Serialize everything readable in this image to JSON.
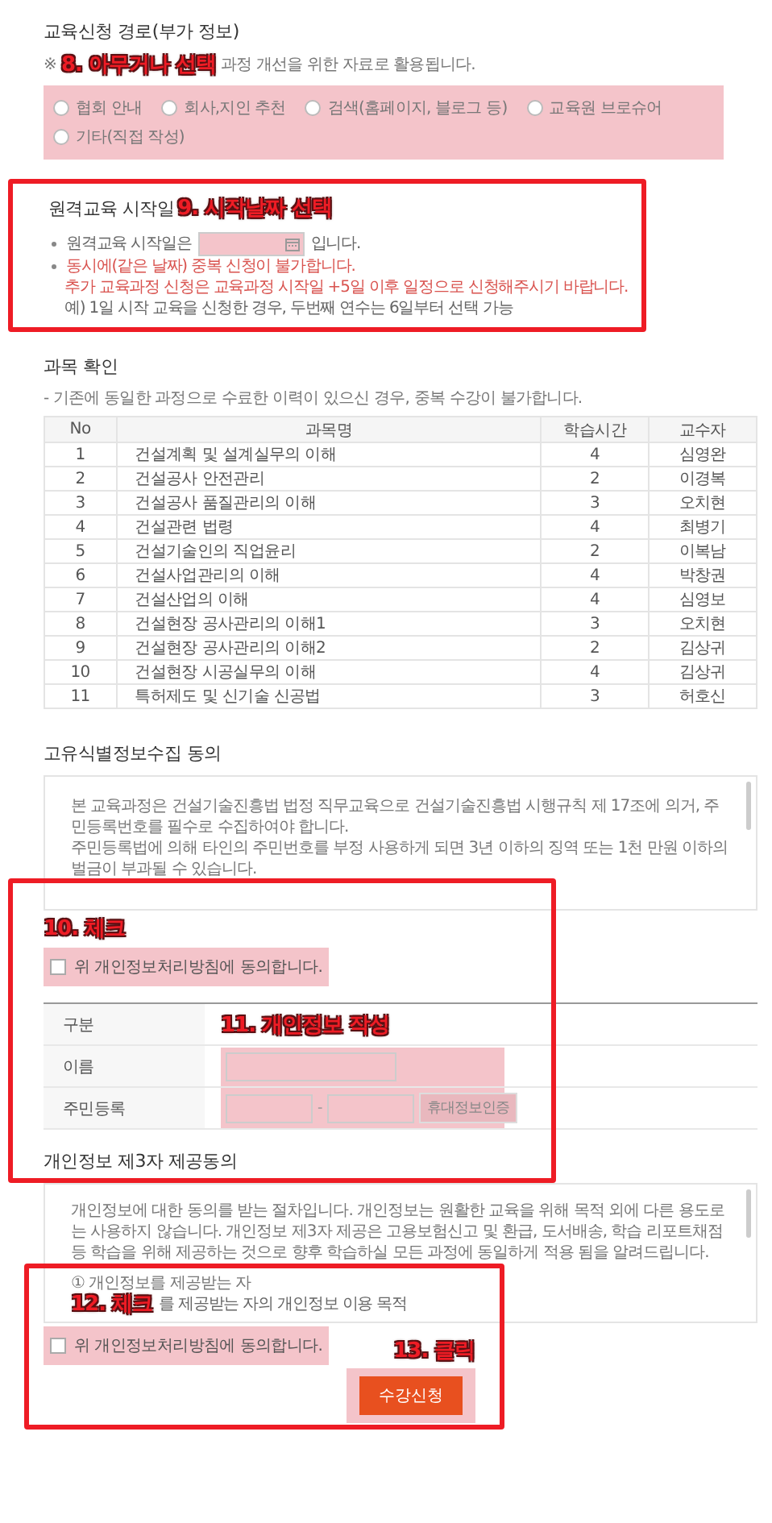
{
  "route": {
    "title": "교육신청 경로(부가 정보)",
    "note_prefix": "※",
    "annotation": "8. 아무거나 선택",
    "note": "과정 개선을 위한 자료로 활용됩니다.",
    "options": [
      {
        "label": "협회 안내",
        "selected": false
      },
      {
        "label": "회사,지인 추천",
        "selected": false
      },
      {
        "label": "검색(홈페이지, 블로그 등)",
        "selected": false
      },
      {
        "label": "교육원 브로슈어",
        "selected": false
      },
      {
        "label": "기타(직접 작성)",
        "selected": false
      }
    ]
  },
  "start_date": {
    "title": "원격교육 시작일",
    "annotation": "9. 시작날짜 선택",
    "prefix": "원격교육 시작일은",
    "suffix": "입니다.",
    "warnings": [
      "동시에(같은 날짜) 중복 신청이 불가합니다.",
      "추가 교육과정 신청은 교육과정 시작일 +5일 이후 일정으로 신청해주시기 바랍니다."
    ],
    "example": "예) 1일 시작 교육을 신청한 경우, 두번째 연수는 6일부터 선택 가능"
  },
  "courses": {
    "title": "과목 확인",
    "note": "- 기존에 동일한 과정으로 수료한 이력이 있으신 경우, 중복 수강이 불가합니다.",
    "columns": [
      "No",
      "과목명",
      "학습시간",
      "교수자"
    ],
    "rows": [
      [
        "1",
        "건설계획 및 설계실무의 이해",
        "4",
        "심영완"
      ],
      [
        "2",
        "건설공사 안전관리",
        "2",
        "이경복"
      ],
      [
        "3",
        "건설공사 품질관리의 이해",
        "3",
        "오치현"
      ],
      [
        "4",
        "건설관련 법령",
        "4",
        "최병기"
      ],
      [
        "5",
        "건설기술인의 직업윤리",
        "2",
        "이복남"
      ],
      [
        "6",
        "건설사업관리의 이해",
        "4",
        "박창권"
      ],
      [
        "7",
        "건설산업의 이해",
        "4",
        "심영보"
      ],
      [
        "8",
        "건설현장 공사관리의 이해1",
        "3",
        "오치현"
      ],
      [
        "9",
        "건설현장 공사관리의 이해2",
        "2",
        "김상귀"
      ],
      [
        "10",
        "건설현장 시공실무의 이해",
        "4",
        "김상귀"
      ],
      [
        "11",
        "특허제도 및 신기술 신공법",
        "3",
        "허호신"
      ]
    ]
  },
  "unique_id_consent": {
    "title": "고유식별정보수집 동의",
    "paragraphs": [
      "본 교육과정은 건설기술진흥법 법정 직무교육으로 건설기술진흥법 시행규칙 제 17조에 의거, 주민등록번호를 필수로 수집하여야 합니다.",
      "주민등록법에 의해 타인의 주민번호를 부정 사용하게 되면 3년 이하의 징역 또는 1천 만원 이하의 벌금이 부과될 수 있습니다."
    ],
    "annotation": "10. 체크",
    "agree": {
      "label": "위 개인정보처리방침에 동의합니다.",
      "checked": false
    }
  },
  "personal_info": {
    "header": "구분",
    "annotation": "11. 개인정보 작성",
    "rows": [
      {
        "kind": "name",
        "label": "이름"
      },
      {
        "kind": "resident",
        "label": "주민등록",
        "separator": "-",
        "button": "휴대정보인증"
      }
    ]
  },
  "third_party": {
    "title": "개인정보 제3자 제공동의",
    "paragraph": "개인정보에 대한 동의를 받는 절차입니다. 개인정보는 원활한 교육을 위해 목적 외에 다른 용도로는 사용하지 않습니다. 개인정보 제3자 제공은 고용보험신고 및 환급, 도서배송, 학습 리포트채점 등 학습을 위해 제공하는 것으로 향후 학습하실 모든 과정에 동일하게 적용 됨을 알려드립니다.",
    "item": "① 개인정보를 제공받는 자",
    "annotation": "12. 체크",
    "item_rest": "를 제공받는 자의 개인정보 이용 목적",
    "agree": {
      "label": "위 개인정보처리방침에 동의합니다.",
      "checked": false
    }
  },
  "submit": {
    "annotation": "13. 클릭",
    "label": "수강신청"
  }
}
